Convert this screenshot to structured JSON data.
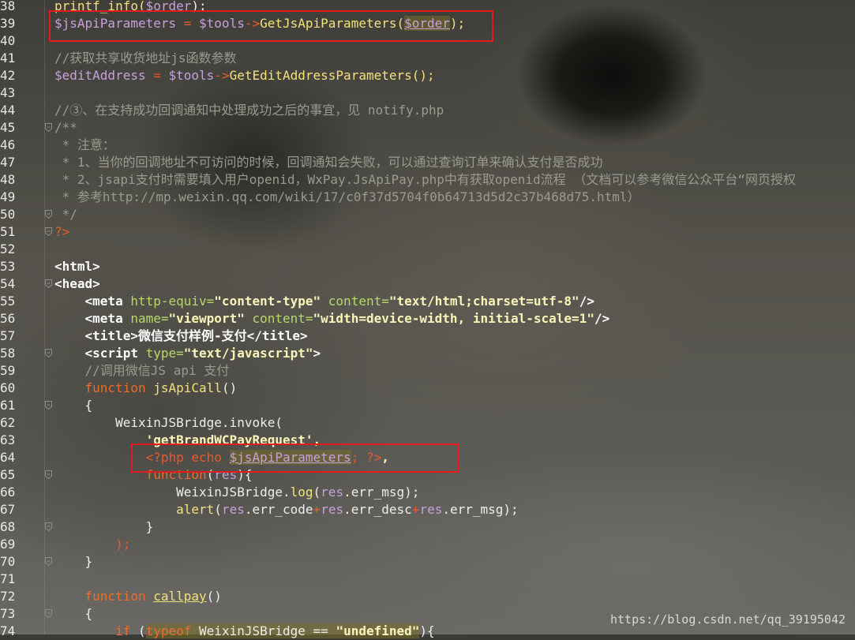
{
  "editor": {
    "lines": [
      {
        "n": "38",
        "fold": false,
        "tokens": [
          {
            "t": "printf_info(",
            "c": "fn"
          },
          {
            "t": "$order",
            "c": "var"
          },
          {
            "t": ");",
            "c": "plain"
          }
        ]
      },
      {
        "n": "39",
        "fold": false,
        "tokens": [
          {
            "t": "$jsApiParameters",
            "c": "var"
          },
          {
            "t": " = ",
            "c": "op"
          },
          {
            "t": "$tools",
            "c": "var"
          },
          {
            "t": "->",
            "c": "op"
          },
          {
            "t": "GetJsApiParameters(",
            "c": "fn"
          },
          {
            "t": "$order",
            "c": "var hl ul"
          },
          {
            "t": ");",
            "c": "fn"
          }
        ]
      },
      {
        "n": "40",
        "fold": false,
        "tokens": []
      },
      {
        "n": "41",
        "fold": false,
        "tokens": [
          {
            "t": "//获取共享收货地址js函数参数",
            "c": "cm"
          }
        ]
      },
      {
        "n": "42",
        "fold": false,
        "tokens": [
          {
            "t": "$editAddress",
            "c": "var"
          },
          {
            "t": " = ",
            "c": "op"
          },
          {
            "t": "$tools",
            "c": "var"
          },
          {
            "t": "->",
            "c": "op"
          },
          {
            "t": "GetEditAddressParameters();",
            "c": "fn"
          }
        ]
      },
      {
        "n": "43",
        "fold": false,
        "tokens": []
      },
      {
        "n": "44",
        "fold": false,
        "tokens": [
          {
            "t": "//③、在支持成功回调通知中处理成功之后的事宜，见 notify.php",
            "c": "cm"
          }
        ]
      },
      {
        "n": "45",
        "fold": true,
        "tokens": [
          {
            "t": "/**",
            "c": "cm"
          }
        ]
      },
      {
        "n": "46",
        "fold": false,
        "tokens": [
          {
            "t": " * 注意：",
            "c": "cm"
          }
        ]
      },
      {
        "n": "47",
        "fold": false,
        "tokens": [
          {
            "t": " * 1、当你的回调地址不可访问的时候，回调通知会失败，可以通过查询订单来确认支付是否成功",
            "c": "cm"
          }
        ]
      },
      {
        "n": "48",
        "fold": false,
        "tokens": [
          {
            "t": " * 2、jsapi支付时需要填入用户openid，WxPay.JsApiPay.php中有获取openid流程 （文档可以参考微信公众平台“网页授权",
            "c": "cm"
          }
        ]
      },
      {
        "n": "49",
        "fold": false,
        "tokens": [
          {
            "t": " * 参考http://mp.weixin.qq.com/wiki/17/c0f37d5704f0b64713d5d2c37b468d75.html）",
            "c": "cm"
          }
        ]
      },
      {
        "n": "50",
        "fold": true,
        "tokens": [
          {
            "t": " */",
            "c": "cm"
          }
        ]
      },
      {
        "n": "51",
        "fold": true,
        "tokens": [
          {
            "t": "?>",
            "c": "op"
          }
        ]
      },
      {
        "n": "52",
        "fold": false,
        "tokens": []
      },
      {
        "n": "53",
        "fold": false,
        "tokens": [
          {
            "t": "<html>",
            "c": "tag"
          }
        ]
      },
      {
        "n": "54",
        "fold": true,
        "tokens": [
          {
            "t": "<head>",
            "c": "tag"
          }
        ]
      },
      {
        "n": "55",
        "fold": false,
        "tokens": [
          {
            "t": "    ",
            "c": "plain"
          },
          {
            "t": "<meta ",
            "c": "tag"
          },
          {
            "t": "http-equiv=",
            "c": "attr"
          },
          {
            "t": "\"content-type\"",
            "c": "str"
          },
          {
            "t": " content=",
            "c": "attr"
          },
          {
            "t": "\"text/html;charset=utf-8\"",
            "c": "str"
          },
          {
            "t": "/>",
            "c": "tag"
          }
        ]
      },
      {
        "n": "56",
        "fold": false,
        "tokens": [
          {
            "t": "    ",
            "c": "plain"
          },
          {
            "t": "<meta ",
            "c": "tag"
          },
          {
            "t": "name=",
            "c": "attr"
          },
          {
            "t": "\"viewport\"",
            "c": "str"
          },
          {
            "t": " content=",
            "c": "attr"
          },
          {
            "t": "\"width=device-width, initial-scale=1\"",
            "c": "str"
          },
          {
            "t": "/>",
            "c": "tag"
          }
        ]
      },
      {
        "n": "57",
        "fold": false,
        "tokens": [
          {
            "t": "    ",
            "c": "plain"
          },
          {
            "t": "<title>",
            "c": "tag"
          },
          {
            "t": "微信支付样例-支付",
            "c": "tag"
          },
          {
            "t": "</title>",
            "c": "tag"
          }
        ]
      },
      {
        "n": "58",
        "fold": true,
        "tokens": [
          {
            "t": "    ",
            "c": "plain"
          },
          {
            "t": "<script ",
            "c": "tag"
          },
          {
            "t": "type=",
            "c": "attr"
          },
          {
            "t": "\"text/javascript\"",
            "c": "str"
          },
          {
            "t": ">",
            "c": "tag"
          }
        ]
      },
      {
        "n": "59",
        "fold": false,
        "tokens": [
          {
            "t": "    //调用微信JS api 支付",
            "c": "cm"
          }
        ]
      },
      {
        "n": "60",
        "fold": false,
        "tokens": [
          {
            "t": "    ",
            "c": "plain"
          },
          {
            "t": "function ",
            "c": "kw"
          },
          {
            "t": "jsApiCall",
            "c": "fn"
          },
          {
            "t": "()",
            "c": "plain"
          }
        ]
      },
      {
        "n": "61",
        "fold": true,
        "tokens": [
          {
            "t": "    {",
            "c": "plain"
          }
        ]
      },
      {
        "n": "62",
        "fold": false,
        "tokens": [
          {
            "t": "        WeixinJSBridge.invoke(",
            "c": "plain"
          }
        ]
      },
      {
        "n": "63",
        "fold": false,
        "tokens": [
          {
            "t": "            ",
            "c": "plain"
          },
          {
            "t": "'getBrandWCPayRequest',",
            "c": "str"
          }
        ]
      },
      {
        "n": "64",
        "fold": false,
        "tokens": [
          {
            "t": "            ",
            "c": "plain"
          },
          {
            "t": "<?php echo ",
            "c": "op"
          },
          {
            "t": "$jsApiParameters",
            "c": "var hl ul"
          },
          {
            "t": "; ?>",
            "c": "op"
          },
          {
            "t": ",",
            "c": "str"
          }
        ]
      },
      {
        "n": "65",
        "fold": true,
        "tokens": [
          {
            "t": "            ",
            "c": "plain"
          },
          {
            "t": "function",
            "c": "kw"
          },
          {
            "t": "(",
            "c": "plain"
          },
          {
            "t": "res",
            "c": "var"
          },
          {
            "t": "){",
            "c": "plain"
          }
        ]
      },
      {
        "n": "66",
        "fold": false,
        "tokens": [
          {
            "t": "                WeixinJSBridge.",
            "c": "plain"
          },
          {
            "t": "log",
            "c": "fn"
          },
          {
            "t": "(",
            "c": "plain"
          },
          {
            "t": "res",
            "c": "var"
          },
          {
            "t": ".err_msg);",
            "c": "plain"
          }
        ]
      },
      {
        "n": "67",
        "fold": false,
        "tokens": [
          {
            "t": "                ",
            "c": "plain"
          },
          {
            "t": "alert",
            "c": "fn"
          },
          {
            "t": "(",
            "c": "plain"
          },
          {
            "t": "res",
            "c": "var"
          },
          {
            "t": ".err_code",
            "c": "plain"
          },
          {
            "t": "+",
            "c": "op"
          },
          {
            "t": "res",
            "c": "var"
          },
          {
            "t": ".err_desc",
            "c": "plain"
          },
          {
            "t": "+",
            "c": "op"
          },
          {
            "t": "res",
            "c": "var"
          },
          {
            "t": ".err_msg);",
            "c": "plain"
          }
        ]
      },
      {
        "n": "68",
        "fold": true,
        "tokens": [
          {
            "t": "            }",
            "c": "plain"
          }
        ]
      },
      {
        "n": "69",
        "fold": false,
        "tokens": [
          {
            "t": "        );",
            "c": "op"
          }
        ]
      },
      {
        "n": "70",
        "fold": true,
        "tokens": [
          {
            "t": "    }",
            "c": "plain"
          }
        ]
      },
      {
        "n": "71",
        "fold": false,
        "tokens": []
      },
      {
        "n": "72",
        "fold": false,
        "tokens": [
          {
            "t": "    ",
            "c": "plain"
          },
          {
            "t": "function ",
            "c": "kw"
          },
          {
            "t": "callpay",
            "c": "fn ul"
          },
          {
            "t": "()",
            "c": "plain"
          }
        ]
      },
      {
        "n": "73",
        "fold": true,
        "tokens": [
          {
            "t": "    {",
            "c": "plain"
          }
        ]
      },
      {
        "n": "74",
        "fold": false,
        "tokens": [
          {
            "t": "        ",
            "c": "plain"
          },
          {
            "t": "if ",
            "c": "kw"
          },
          {
            "t": "(",
            "c": "plain"
          },
          {
            "t": "typeof",
            "c": "kw hl"
          },
          {
            "t": " WeixinJSBridge == ",
            "c": "plain hl"
          },
          {
            "t": "\"undefined\"",
            "c": "str hl"
          },
          {
            "t": "){",
            "c": "plain"
          }
        ]
      }
    ]
  },
  "watermark": "https://blog.csdn.net/qq_39195042",
  "colors": {
    "highlight_box": "#e41b1b"
  }
}
